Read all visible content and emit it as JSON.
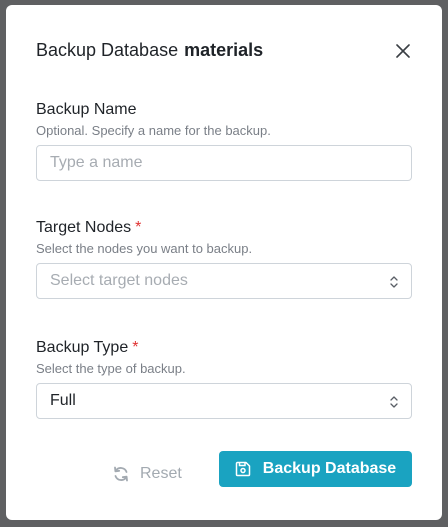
{
  "modal": {
    "title_prefix": "Backup Database",
    "database_name": "materials"
  },
  "fields": {
    "backup_name": {
      "label": "Backup Name",
      "help": "Optional. Specify a name for the backup.",
      "placeholder": "Type a name",
      "value": ""
    },
    "target_nodes": {
      "label": "Target Nodes",
      "required_mark": "*",
      "help": "Select the nodes you want to backup.",
      "placeholder": "Select target nodes"
    },
    "backup_type": {
      "label": "Backup Type",
      "required_mark": "*",
      "help": "Select the type of backup.",
      "selected": "Full"
    }
  },
  "actions": {
    "reset_label": "Reset",
    "submit_label": "Backup Database"
  },
  "colors": {
    "accent": "#1aa3c1",
    "required": "#e03131",
    "backdrop": "#5f6062"
  },
  "icons": {
    "close": "close-icon",
    "chevron": "chevron-up-down-icon",
    "reset": "refresh-icon",
    "submit": "save-icon"
  }
}
